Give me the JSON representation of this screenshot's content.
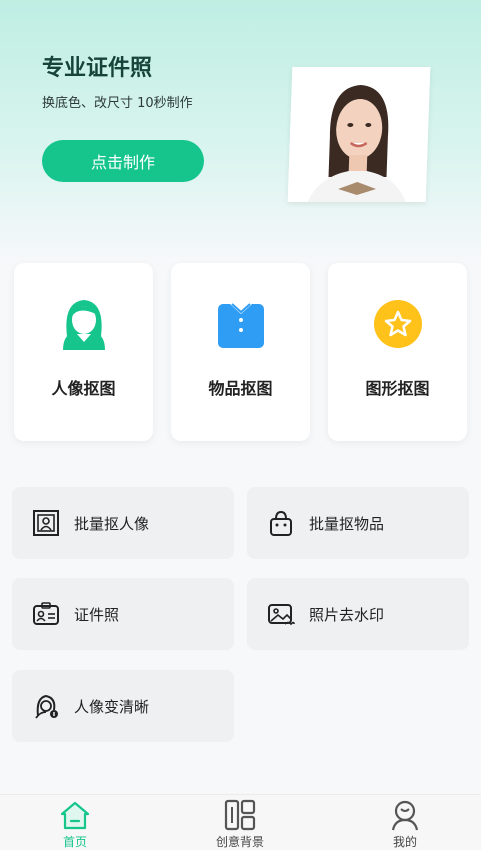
{
  "hero": {
    "title": "专业证件照",
    "subtitle": "换底色、改尺寸 10秒制作",
    "button_label": "点击制作"
  },
  "cards": [
    {
      "label": "人像抠图",
      "icon": "person-portrait-icon",
      "color": "#15c58c"
    },
    {
      "label": "物品抠图",
      "icon": "shirt-icon",
      "color": "#2f9df4"
    },
    {
      "label": "图形抠图",
      "icon": "star-circle-icon",
      "color": "#ffc21b"
    }
  ],
  "tools": [
    {
      "label": "批量抠人像",
      "icon": "batch-portrait-icon"
    },
    {
      "label": "批量抠物品",
      "icon": "bag-icon"
    },
    {
      "label": "证件照",
      "icon": "id-card-icon"
    },
    {
      "label": "照片去水印",
      "icon": "image-watermark-icon"
    },
    {
      "label": "人像变清晰",
      "icon": "portrait-enhance-icon"
    }
  ],
  "tabbar": [
    {
      "label": "首页",
      "icon": "home-icon",
      "active": true
    },
    {
      "label": "创意背景",
      "icon": "layout-icon",
      "active": false
    },
    {
      "label": "我的",
      "icon": "user-icon",
      "active": false
    }
  ],
  "colors": {
    "accent": "#15c58c"
  }
}
